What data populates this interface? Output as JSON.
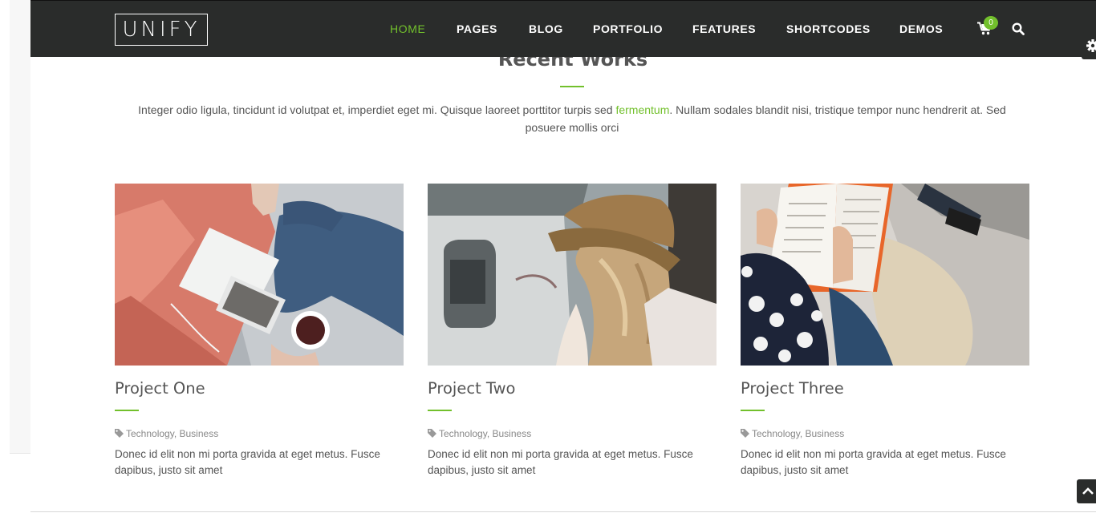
{
  "brand": {
    "logo_text": "UNIFY"
  },
  "nav": {
    "items": [
      {
        "label": "HOME",
        "active": true
      },
      {
        "label": "PAGES"
      },
      {
        "label": "BLOG"
      },
      {
        "label": "PORTFOLIO"
      },
      {
        "label": "FEATURES"
      },
      {
        "label": "SHORTCODES"
      },
      {
        "label": "DEMOS"
      }
    ],
    "cart_count": "0",
    "cart_icon": "shopping-cart-icon",
    "search_icon": "search-icon"
  },
  "section": {
    "title": "Recent Works",
    "intro_before": "Integer odio ligula, tincidunt id volutpat et, imperdiet eget mi. Quisque laoreet porttitor turpis sed ",
    "intro_link": "fermentum",
    "intro_after": ". Nullam sodales blandit nisi, tristique tempor nunc hendrerit at. Sed posuere mollis orci"
  },
  "projects": [
    {
      "title": "Project One",
      "tags": [
        "Technology",
        "Business"
      ],
      "description": "Donec id elit non mi porta gravida at eget metus. Fusce dapibus, justo sit amet"
    },
    {
      "title": "Project Two",
      "tags": [
        "Technology",
        "Business"
      ],
      "description": "Donec id elit non mi porta gravida at eget metus. Fusce dapibus, justo sit amet"
    },
    {
      "title": "Project Three",
      "tags": [
        "Technology",
        "Business"
      ],
      "description": "Donec id elit non mi porta gravida at eget metus. Fusce dapibus, justo sit amet"
    }
  ],
  "widgets": {
    "settings_icon": "gear-icon",
    "back_to_top_icon": "chevron-up-icon"
  },
  "colors": {
    "accent": "#72c02c",
    "header_bg": "#2a2c2b",
    "text": "#555555"
  }
}
